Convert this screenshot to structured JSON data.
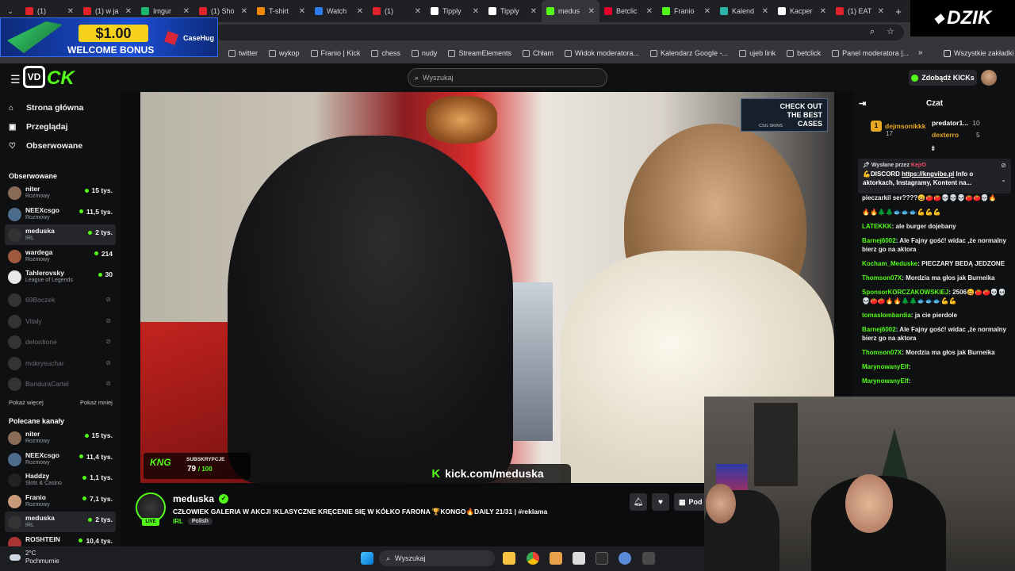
{
  "browser": {
    "tabs": [
      {
        "label": "(1) ",
        "color": "#e0222a"
      },
      {
        "label": "(1) w ja",
        "color": "#e0222a"
      },
      {
        "label": "Imgur",
        "color": "#1bb76e"
      },
      {
        "label": "(1) Sho",
        "color": "#e0222a"
      },
      {
        "label": "T-shirt",
        "color": "#f08804"
      },
      {
        "label": "Watch",
        "color": "#2b7de9"
      },
      {
        "label": "(1)",
        "color": "#e0222a"
      },
      {
        "label": "Tipply",
        "color": "#ffffff"
      },
      {
        "label": "Tipply",
        "color": "#ffffff"
      },
      {
        "label": "medus",
        "color": "#53fc18"
      },
      {
        "label": "Betclic",
        "color": "#e4002b"
      },
      {
        "label": "Franio",
        "color": "#53fc18"
      },
      {
        "label": "Kalend",
        "color": "#2bb5a8"
      },
      {
        "label": "Kacper",
        "color": "#ffffff"
      },
      {
        "label": "(1) EAT",
        "color": "#e0222a"
      }
    ],
    "active_tab_index": 9,
    "bookmarks": [
      {
        "label": "twitter",
        "icon": "x-icon"
      },
      {
        "label": "wykop",
        "icon": "wykop-icon"
      },
      {
        "label": "Franio | Kick",
        "icon": "kick-icon"
      },
      {
        "label": "chess",
        "icon": "chess-icon"
      },
      {
        "label": "nudy",
        "icon": "folder-icon"
      },
      {
        "label": "StreamElements",
        "icon": "streamelements-icon"
      },
      {
        "label": "Chłam",
        "icon": "globe-icon"
      },
      {
        "label": "Widok moderatora...",
        "icon": "twitch-icon"
      },
      {
        "label": "Kalendarz Google -...",
        "icon": "calendar-icon"
      },
      {
        "label": "ujeb link",
        "icon": "globe-icon"
      },
      {
        "label": "betclick",
        "icon": "globe-icon"
      },
      {
        "label": "Panel moderatora |...",
        "icon": "kick-icon"
      }
    ],
    "all_bookmarks": "Wszystkie zakładki"
  },
  "ad": {
    "price": "$1.00",
    "bonus": "WELCOME BONUS",
    "brand": "CaseHug"
  },
  "overlay_logo": "DZIK",
  "header": {
    "search_placeholder": "Wyszukaj",
    "get_kicks": "Zdobądź KICKs"
  },
  "sidebar": {
    "nav": [
      {
        "label": "Strona główna",
        "icon": "home-icon"
      },
      {
        "label": "Przeglądaj",
        "icon": "browse-icon"
      },
      {
        "label": "Obserwowane",
        "icon": "heart-icon"
      }
    ],
    "followed_title": "Obserwowane",
    "followed": [
      {
        "name": "niter",
        "category": "Rozmowy",
        "viewers": "15 tys.",
        "color": "#8a6b55"
      },
      {
        "name": "NEEXcsgo",
        "category": "Rozmowy",
        "viewers": "11,5 tys.",
        "color": "#4d6b8a"
      },
      {
        "name": "meduska",
        "category": "IRL",
        "viewers": "2 tys.",
        "color": "#333333"
      },
      {
        "name": "wardega",
        "category": "Rozmowy",
        "viewers": "214",
        "color": "#a0583f"
      },
      {
        "name": "Tahlerovsky",
        "category": "League of Legends",
        "viewers": "30",
        "color": "#e8e8e8"
      }
    ],
    "offline": [
      {
        "name": "69Boczek",
        "color": "#777777"
      },
      {
        "name": "Vitaly",
        "color": "#777777"
      },
      {
        "name": "delordione",
        "color": "#777777"
      },
      {
        "name": "mokrysuchar",
        "color": "#777777"
      },
      {
        "name": "BanduraCartel",
        "color": "#777777"
      }
    ],
    "show_more": "Pokaż więcej",
    "show_less": "Pokaż mniej",
    "recommended_title": "Polecane kanały",
    "recommended": [
      {
        "name": "niter",
        "category": "Rozmowy",
        "viewers": "15 tys.",
        "color": "#8a6b55"
      },
      {
        "name": "NEEXcsgo",
        "category": "Rozmowy",
        "viewers": "11,4 tys.",
        "color": "#4d6b8a"
      },
      {
        "name": "Haddzy",
        "category": "Slots & Casino",
        "viewers": "1,1 tys.",
        "color": "#222222"
      },
      {
        "name": "Franio",
        "category": "Rozmowy",
        "viewers": "7,1 tys.",
        "color": "#c99a7a"
      },
      {
        "name": "meduska",
        "category": "IRL",
        "viewers": "2 tys.",
        "color": "#333333"
      },
      {
        "name": "ROSHTEIN",
        "category": "",
        "viewers": "10,4 tys.",
        "color": "#aa3333"
      }
    ]
  },
  "weather": {
    "temp": "2°C",
    "condition": "Pochmurnie"
  },
  "video": {
    "promo_text": "CHECK OUT THE BEST CASES",
    "promo_sub": "CSG SKINS",
    "sub_label": "SUBSKRYPCJE",
    "sub_count": "79",
    "sub_goal": "/ 100",
    "sub_logo": "KNG",
    "url": "kick.com/meduska"
  },
  "stream": {
    "name": "meduska",
    "title": "CZŁOWIEK GALERIA W AKCJI !KLASYCZNE KRĘCENIE SIĘ W KÓŁKO FARONA 🏆KONGO🔥DAILY 21/31 | #reklama",
    "category": "IRL",
    "tag": "Polish",
    "live": "LIVE",
    "subscribe": "Pod"
  },
  "chat": {
    "title": "Czat",
    "gifters": [
      {
        "name": "dejmsonikkk",
        "count": "17"
      },
      {
        "name": "predator1...",
        "count": "10"
      },
      {
        "name": "dexterro",
        "count": "5"
      }
    ],
    "pinned_by_label": "Wysłane przez",
    "pinned_by_user": "KejrO",
    "pinned_text_pre": "💪DISCORD ",
    "pinned_link": "https://kngvibe.pl",
    "pinned_text_post": " Info o aktorkach, Instagramy, Kontent na...",
    "messages": [
      {
        "user": "",
        "text": "pieczarkil ser????😄🍅🍅💀💀💀🍅🍅💀🔥"
      },
      {
        "user": "",
        "text": "🔥🔥🌲🌲🐟🐟🐟💪💪💪"
      },
      {
        "user": "LATEKKK",
        "text": "ale burger dojebany"
      },
      {
        "user": "Barnej6002",
        "text": "Ale Fajny gość! widac ,że normalny bierz go na aktora"
      },
      {
        "user": "Kocham_Meduske",
        "text": "PIECZARY BEDĄ JEDZONE"
      },
      {
        "user": "Thomson07X",
        "text": "Mordzia ma głos jak Burneika"
      },
      {
        "user": "SponsorKORCZAKOWSKIEJ",
        "text": "2506😄🍅🍅💀💀💀🍅🍅🔥🔥🌲🌲🐟🐟🐟💪💪"
      },
      {
        "user": "tomaslombardia",
        "text": "ja cie pierdole"
      },
      {
        "user": "Barnej6002",
        "text": "Ale Fajny gość! widac ,że normalny bierz go na aktora"
      },
      {
        "user": "Thomson07X",
        "text": "Mordzia ma głos jak Burneika"
      },
      {
        "user": "MarynowanyElf",
        "text": ""
      },
      {
        "user": "MarynowanyElf",
        "text": ""
      }
    ]
  },
  "taskbar": {
    "search_placeholder": "Wyszukaj"
  }
}
